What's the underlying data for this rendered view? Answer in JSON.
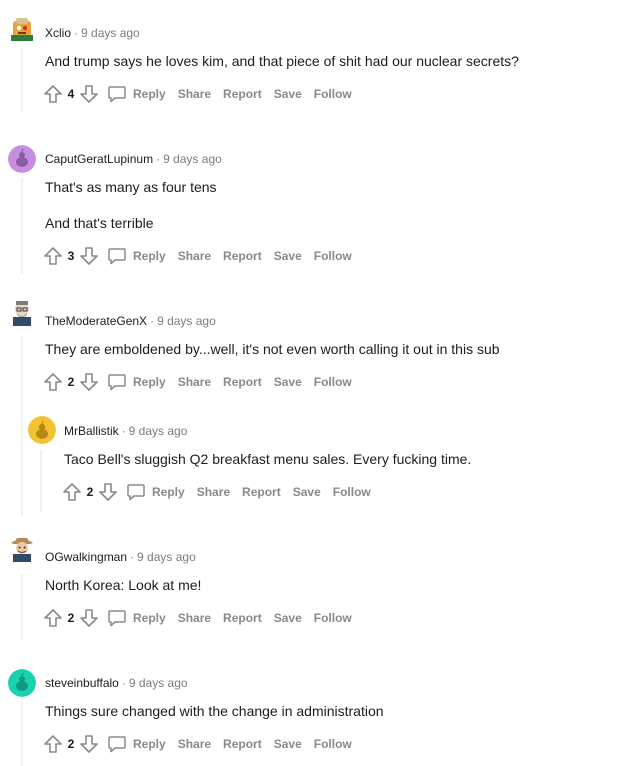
{
  "actions": {
    "reply": "Reply",
    "share": "Share",
    "report": "Report",
    "save": "Save",
    "follow": "Follow"
  },
  "comments": [
    {
      "author": "Xclio",
      "time": "9 days ago",
      "votes": "4",
      "lines": [
        "And trump says he loves kim, and that piece of shit had our nuclear secrets?"
      ],
      "avatar_color": "#e8a33d"
    },
    {
      "author": "CaputGeratLupinum",
      "time": "9 days ago",
      "votes": "3",
      "lines": [
        "That's as many as four tens",
        "And that's terrible"
      ],
      "avatar_color": "#c68ee0"
    },
    {
      "author": "TheModerateGenX",
      "time": "9 days ago",
      "votes": "2",
      "lines": [
        "They are emboldened by...well, it's not even worth calling it out in this sub"
      ],
      "avatar_color": "#6d7f99"
    },
    {
      "author": "MrBallistik",
      "time": "9 days ago",
      "votes": "2",
      "lines": [
        "Taco Bell's sluggish Q2 breakfast menu sales. Every fucking time."
      ],
      "avatar_color": "#f2c230"
    },
    {
      "author": "OGwalkingman",
      "time": "9 days ago",
      "votes": "2",
      "lines": [
        "North Korea: Look at me!"
      ],
      "avatar_color": "#b58a5c"
    },
    {
      "author": "steveinbuffalo",
      "time": "9 days ago",
      "votes": "2",
      "lines": [
        "Things sure changed with the change in administration"
      ],
      "avatar_color": "#1ad1b0"
    }
  ]
}
